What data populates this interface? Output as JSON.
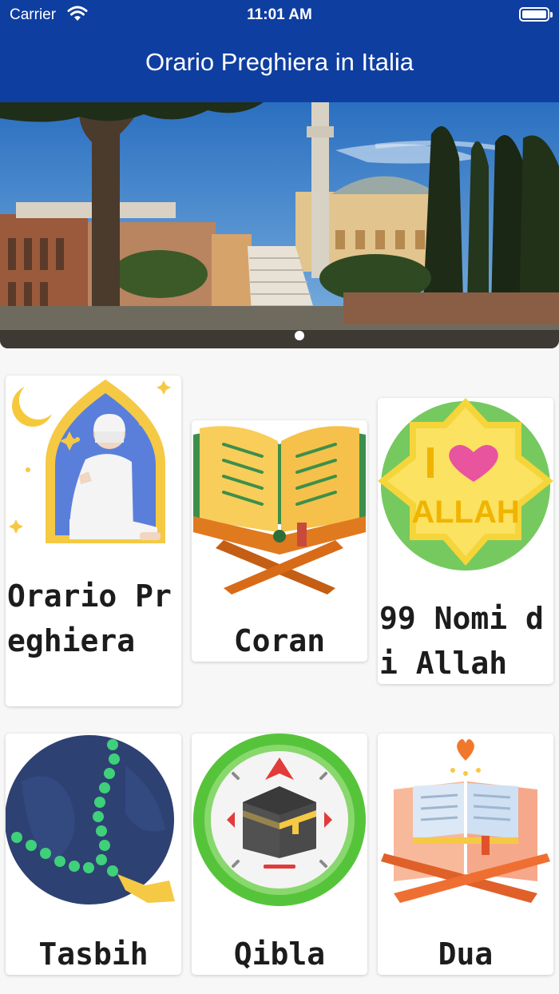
{
  "status_bar": {
    "carrier": "Carrier",
    "time": "11:01 AM"
  },
  "header": {
    "title": "Orario Preghiera in Italia"
  },
  "carousel": {
    "pages": 1,
    "current": 1
  },
  "menu": [
    {
      "label": "Orario Preghiera",
      "icon": "prayer-man-icon"
    },
    {
      "label": "Coran",
      "icon": "quran-book-icon"
    },
    {
      "label": "99 Nomi di Allah",
      "icon": "i-love-allah-icon"
    },
    {
      "label": "Tasbih",
      "icon": "prayer-beads-icon"
    },
    {
      "label": "Qibla",
      "icon": "kaaba-compass-icon"
    },
    {
      "label": "Dua",
      "icon": "open-book-heart-icon"
    }
  ],
  "colors": {
    "header": "#0f3ea1",
    "accent_green": "#4cc43a",
    "accent_yellow": "#f5c944"
  }
}
